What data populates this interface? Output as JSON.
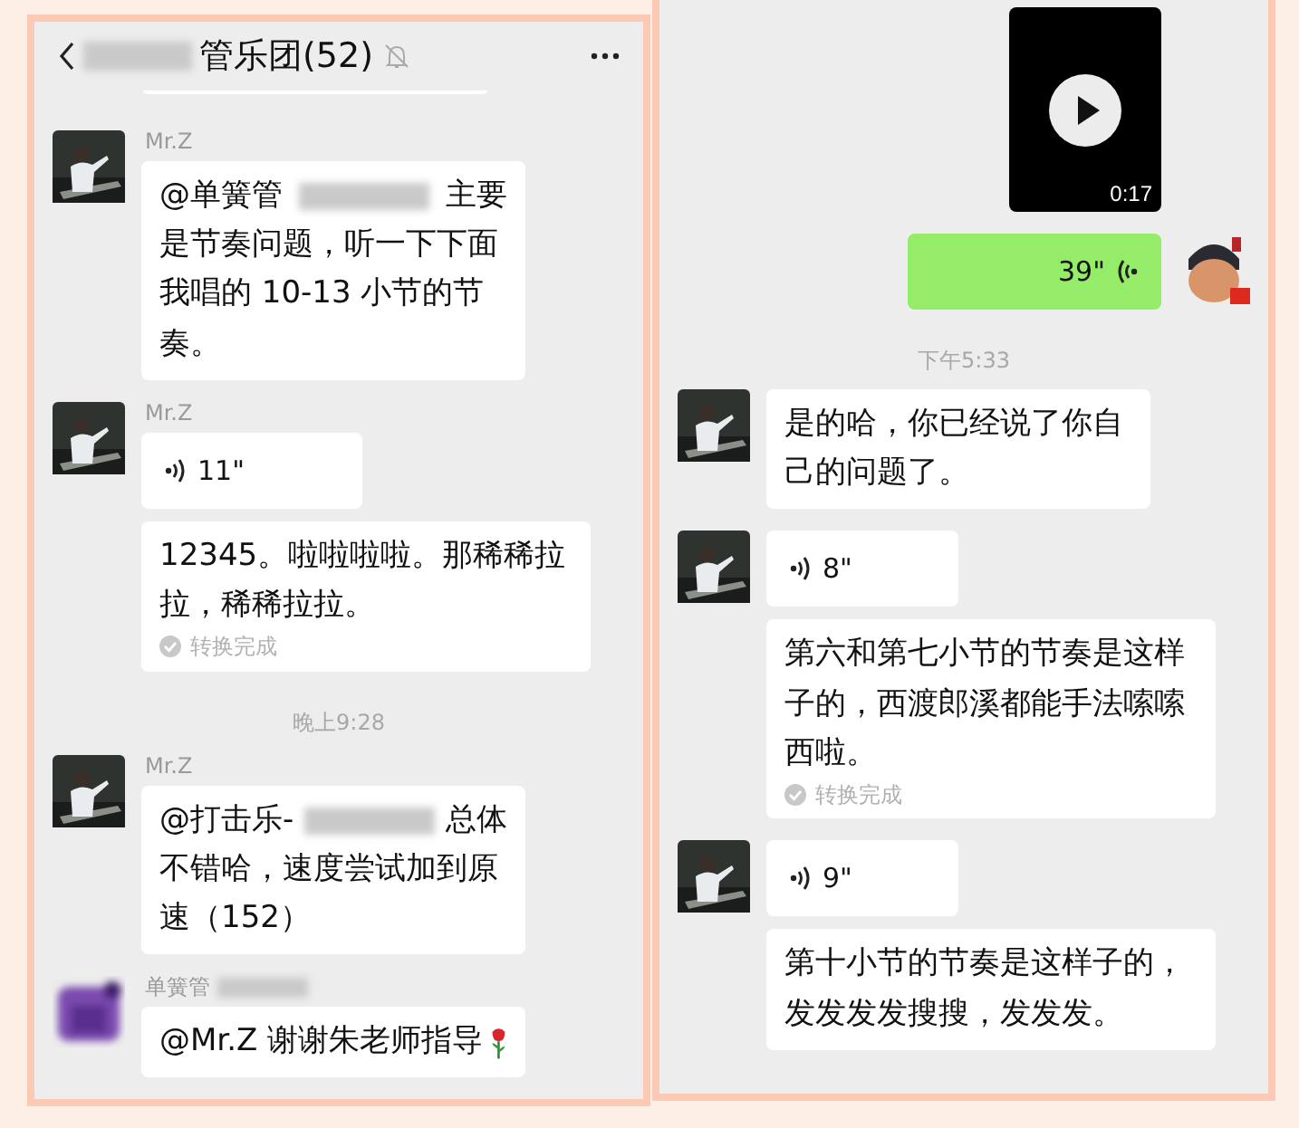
{
  "left": {
    "header": {
      "title_parts": [
        {
          "kind": "blur"
        },
        {
          "kind": "text",
          "text": "管乐团(52)"
        }
      ],
      "muted": true
    },
    "messages": [
      {
        "kind": "cut"
      },
      {
        "kind": "text",
        "outgoing": false,
        "sender_parts": [
          {
            "kind": "text",
            "text": "Mr.Z"
          }
        ],
        "lead_parts": [
          {
            "kind": "text",
            "text": "@单簧管"
          },
          {
            "kind": "blur"
          },
          {
            "kind": "text",
            "text": "主要"
          }
        ],
        "text": "是节奏问题，听一下下面我唱的 10-13 小节的节奏。"
      },
      {
        "kind": "voice",
        "outgoing": false,
        "sender_parts": [
          {
            "kind": "text",
            "text": "Mr.Z"
          }
        ],
        "duration": "11\""
      },
      {
        "kind": "transcript",
        "text": "12345。啦啦啦啦。那稀稀拉拉，稀稀拉拉。",
        "status": "转换完成"
      },
      {
        "kind": "time",
        "text": "晚上9:28"
      },
      {
        "kind": "text",
        "outgoing": false,
        "sender_parts": [
          {
            "kind": "text",
            "text": "Mr.Z"
          }
        ],
        "lead_parts": [
          {
            "kind": "text",
            "text": "@打击乐-"
          },
          {
            "kind": "blur"
          },
          {
            "kind": "text",
            "text": "总体"
          }
        ],
        "text": "不错哈，速度尝试加到原速（152）"
      },
      {
        "kind": "text",
        "outgoing": false,
        "sender_parts": [
          {
            "kind": "text",
            "text": "单簧管"
          },
          {
            "kind": "blur"
          }
        ],
        "lead_parts": [
          {
            "kind": "text",
            "text": "@Mr.Z 谢谢朱老师指导"
          },
          {
            "kind": "rose"
          }
        ]
      }
    ]
  },
  "right": {
    "messages": [
      {
        "kind": "cut"
      },
      {
        "kind": "video",
        "duration": "0:17"
      },
      {
        "kind": "voice",
        "outgoing": true,
        "duration": "39\""
      },
      {
        "kind": "time",
        "text": "下午5:33"
      },
      {
        "kind": "text",
        "outgoing": false,
        "text": "是的哈，你已经说了你自己的问题了。"
      },
      {
        "kind": "voice",
        "outgoing": false,
        "duration": "8\""
      },
      {
        "kind": "transcript",
        "text": "第六和第七小节的节奏是这样子的，西渡郎溪都能手法嗦嗦西啦。",
        "status": "转换完成"
      },
      {
        "kind": "voice",
        "outgoing": false,
        "duration": "9\""
      },
      {
        "kind": "transcript",
        "text": "第十小节的节奏是这样子的，发发发发搜搜，发发发。"
      }
    ]
  }
}
